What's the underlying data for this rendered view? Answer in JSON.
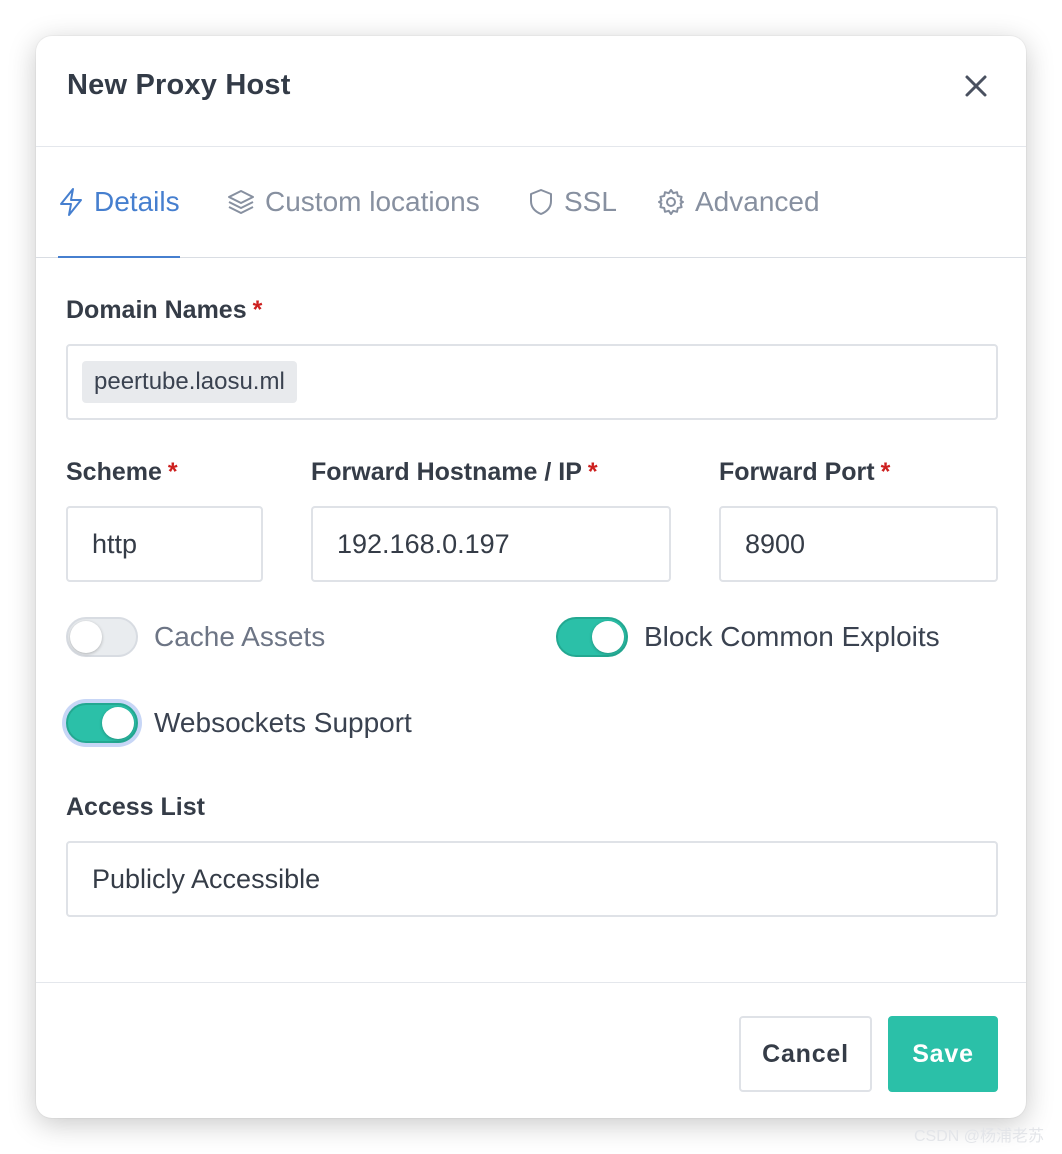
{
  "modal": {
    "title": "New Proxy Host",
    "close_icon": "close-icon"
  },
  "tabs": [
    {
      "label": "Details",
      "icon": "lightning-bolt-icon",
      "active": true
    },
    {
      "label": "Custom locations",
      "icon": "layers-icon",
      "active": false
    },
    {
      "label": "SSL",
      "icon": "shield-icon",
      "active": false
    },
    {
      "label": "Advanced",
      "icon": "gear-icon",
      "active": false
    }
  ],
  "form": {
    "domain_names": {
      "label": "Domain Names",
      "required_mark": "*",
      "chips": [
        "peertube.laosu.ml"
      ]
    },
    "scheme": {
      "label": "Scheme",
      "required_mark": "*",
      "value": "http"
    },
    "forward_hostname": {
      "label": "Forward Hostname / IP",
      "required_mark": "*",
      "value": "192.168.0.197"
    },
    "forward_port": {
      "label": "Forward Port",
      "required_mark": "*",
      "value": "8900"
    },
    "toggles": {
      "cache_assets": {
        "label": "Cache Assets",
        "checked": false
      },
      "block_common_exploits": {
        "label": "Block Common Exploits",
        "checked": true
      },
      "websockets_support": {
        "label": "Websockets Support",
        "checked": true
      }
    },
    "access_list": {
      "label": "Access List",
      "value": "Publicly Accessible"
    }
  },
  "footer": {
    "cancel_label": "Cancel",
    "save_label": "Save"
  },
  "watermark": "CSDN @杨浦老苏",
  "colors": {
    "accent": "#467fcf",
    "toggle_on": "#2bc0a8",
    "save_button": "#2bc0a8",
    "required": "#cd201f"
  }
}
